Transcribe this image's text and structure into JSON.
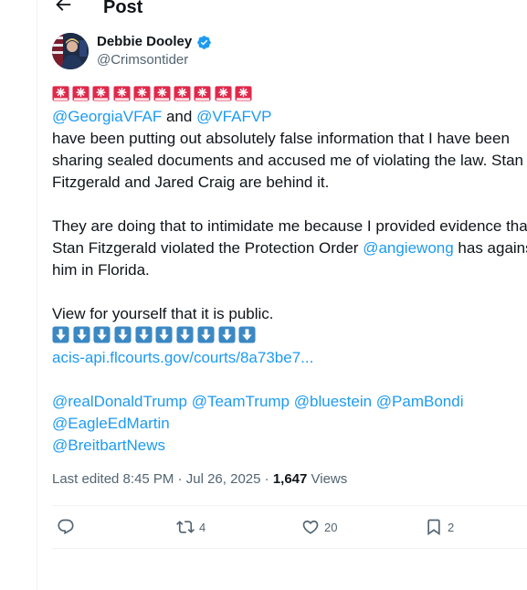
{
  "header": {
    "title": "Post"
  },
  "author": {
    "name": "Debbie Dooley",
    "handle": "@Crimsontider"
  },
  "tweet": {
    "line2_mention1": "@GeorgiaVFAF",
    "line2_and": " and ",
    "line2_mention2": "@VFAFVP",
    "line3": "have been putting out absolutely false information that I have been",
    "line4": "sharing sealed documents and accused me of violating the law. Stan",
    "line5": "Fitzgerald and Jared Craig are behind it.",
    "line7": "They are doing that to intimidate me because I provided evidence that",
    "line8_before": "Stan Fitzgerald violated the Protection Order ",
    "line8_mention": "@angiewong",
    "line8_after": " has against",
    "line9": "him in Florida.",
    "line11": "View for yourself that it is public.",
    "link": "acis-api.flcourts.gov/courts/8a73be7...",
    "mentions_line1": [
      "@realDonaldTrump",
      "@TeamTrump",
      "@bluestein",
      "@PamBondi"
    ],
    "mentions_line2": "@EagleEdMartin",
    "mentions_line3": "@BreitbartNews",
    "siren_emoji_count": 10,
    "down_arrow_emoji_count": 10
  },
  "meta": {
    "edited": "Last edited 8:45 PM · Jul 26, 2025 · ",
    "views_count": "1,647",
    "views_label": " Views"
  },
  "actions": {
    "reply_count": "",
    "retweet_count": "4",
    "like_count": "20",
    "bookmark_count": "2"
  },
  "colors": {
    "link": "#1d9bf0",
    "text": "#0f1419",
    "muted": "#536471",
    "border": "#eff3f4",
    "verified": "#1d9bf0",
    "siren_red": "#e0284a"
  }
}
